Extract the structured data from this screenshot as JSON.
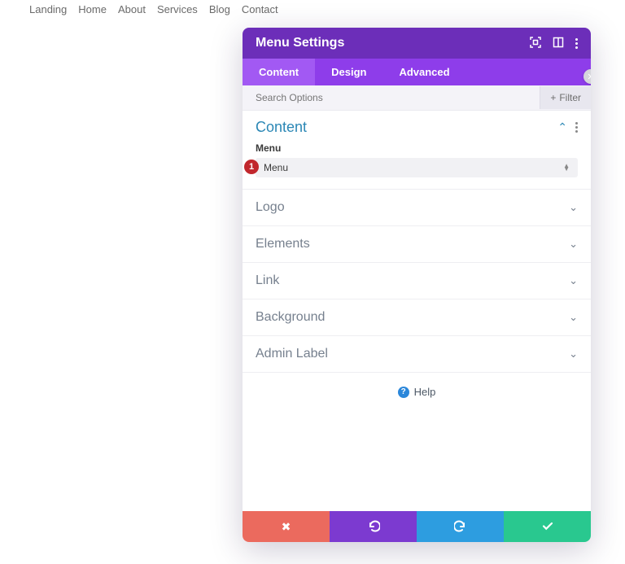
{
  "page_nav": [
    "Landing",
    "Home",
    "About",
    "Services",
    "Blog",
    "Contact"
  ],
  "modal": {
    "title": "Menu Settings",
    "tabs": [
      "Content",
      "Design",
      "Advanced"
    ],
    "active_tab": 0,
    "search_placeholder": "Search Options",
    "filter_label": "Filter",
    "content": {
      "section_title": "Content",
      "field_label": "Menu",
      "field_value": "Menu",
      "badge_number": "1"
    },
    "sections": [
      "Logo",
      "Elements",
      "Link",
      "Background",
      "Admin Label"
    ],
    "help_label": "Help"
  }
}
